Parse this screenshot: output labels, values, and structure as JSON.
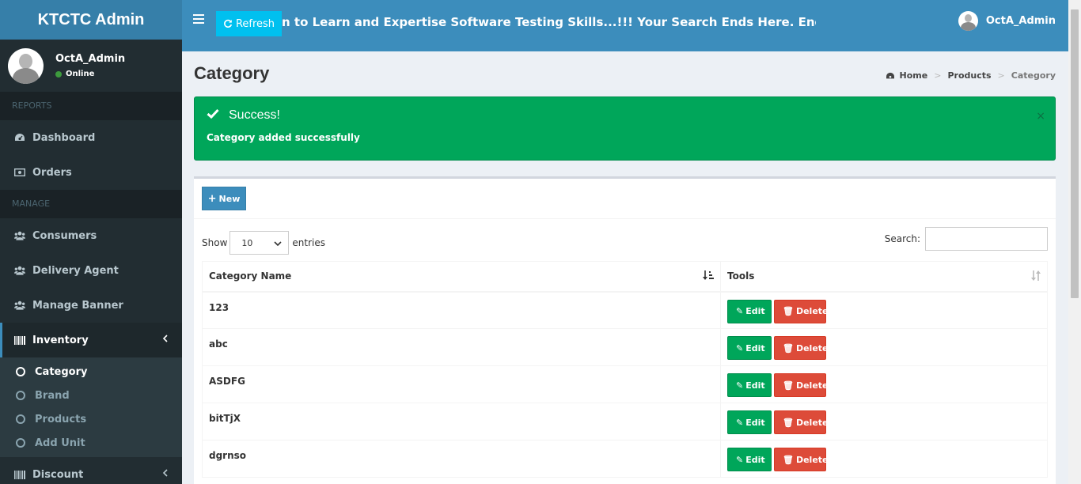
{
  "brand": "KTCTC Admin",
  "user": {
    "name": "OctA_Admin",
    "status": "Online"
  },
  "sidebar": {
    "reports_header": "REPORTS",
    "reports": [
      {
        "label": "Dashboard",
        "icon": "dashboard-icon"
      },
      {
        "label": "Orders",
        "icon": "money-icon"
      }
    ],
    "manage_header": "MANAGE",
    "manage": [
      {
        "label": "Consumers",
        "icon": "users-icon"
      },
      {
        "label": "Delivery Agent",
        "icon": "users-icon"
      },
      {
        "label": "Manage Banner",
        "icon": "users-icon"
      }
    ],
    "inventory": {
      "label": "Inventory",
      "icon": "barcode-icon"
    },
    "inventory_sub": [
      "Category",
      "Brand",
      "Products",
      "Add Unit"
    ],
    "discount": {
      "label": "Discount",
      "icon": "barcode-icon"
    }
  },
  "header": {
    "refresh_label": "Refresh",
    "marquee_text": "n to Learn and Expertise Software Testing Skills...!!! Your Search Ends Here. Enquire Now wi",
    "user_name": "OctA_Admin"
  },
  "page": {
    "title": "Category",
    "breadcrumb": [
      "Home",
      "Products",
      "Category"
    ]
  },
  "alert": {
    "title": "Success!",
    "message": "Category added successfully",
    "close": "×"
  },
  "table_controls": {
    "new_label": "New",
    "show_label": "Show",
    "entries_value": "10",
    "entries_label": "entries",
    "search_label": "Search:"
  },
  "table": {
    "columns": [
      "Category Name",
      "Tools"
    ],
    "rows": [
      "123",
      "abc",
      "ASDFG",
      "bitTjX",
      "dgrnso"
    ],
    "edit_label": "Edit",
    "delete_label": "Delete"
  },
  "colors": {
    "header_blue": "#3c8dbc",
    "brand_blue": "#367fa9",
    "sidebar_dark": "#222d32",
    "success_green": "#00a65a",
    "danger_red": "#dd4b39",
    "refresh_cyan": "#00c0ef"
  }
}
